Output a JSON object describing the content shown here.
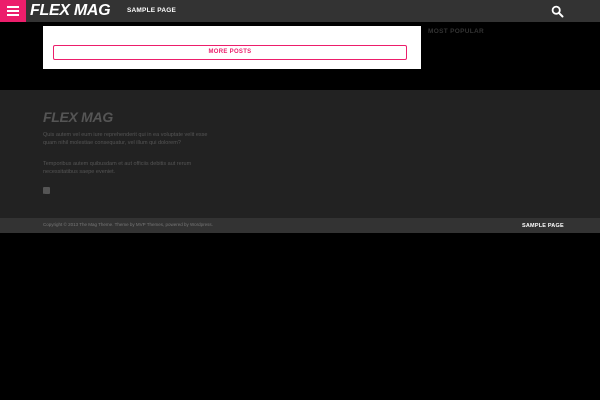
{
  "header": {
    "logo": "FLEX MAG",
    "nav_link": "SAMPLE PAGE",
    "menu_icon": "hamburger-menu-icon",
    "search_icon": "search-icon"
  },
  "main": {
    "more_posts_label": "MORE POSTS",
    "sidebar_title": "MOST POPULAR"
  },
  "footer": {
    "logo": "FLEX MAG",
    "paragraph1": "Quis autem vel eum iure reprehenderit qui in ea voluptate velit esse quam nihil molestiae consequatur, vel illum qui dolorem?",
    "paragraph2": "Temporibus autem quibusdam et aut officiis debitis aut rerum necessitatibus saepe eveniet.",
    "rss_icon": "rss-icon"
  },
  "bottom": {
    "copyright": "Copyright © 2013 The Mag Theme. Theme by MVP Themes, powered by Wordpress.",
    "nav_link": "SAMPLE PAGE"
  },
  "colors": {
    "accent": "#ec1e6b",
    "header_bg": "#333333",
    "footer_bg": "#222222",
    "page_bg": "#000000"
  }
}
